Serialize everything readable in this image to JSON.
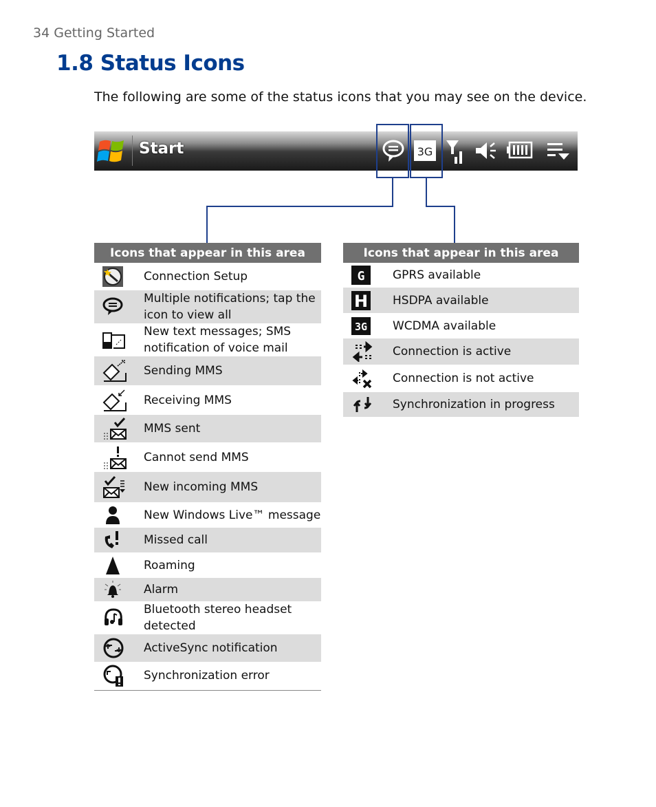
{
  "page_header": "34  Getting Started",
  "title": "1.8  Status Icons",
  "intro": "The following are some of the status icons that you may see on the device.",
  "taskbar": {
    "start_label": "Start",
    "icons": [
      "windows-logo",
      "notification-bubble",
      "3g",
      "signal",
      "speaker",
      "battery",
      "menu-dropdown"
    ],
    "highlighted": [
      "notification-bubble",
      "3g"
    ]
  },
  "left_table": {
    "header": "Icons that appear in this area",
    "rows": [
      {
        "icon": "connection-setup",
        "label": "Connection Setup"
      },
      {
        "icon": "multiple-notifications",
        "label": "Multiple notifications; tap the icon to view all"
      },
      {
        "icon": "new-text-messages",
        "label": "New text messages; SMS notification of voice mail"
      },
      {
        "icon": "sending-mms",
        "label": "Sending MMS"
      },
      {
        "icon": "receiving-mms",
        "label": "Receiving MMS"
      },
      {
        "icon": "mms-sent",
        "label": "MMS sent"
      },
      {
        "icon": "cannot-send-mms",
        "label": "Cannot send MMS"
      },
      {
        "icon": "new-incoming-mms",
        "label": "New incoming MMS"
      },
      {
        "icon": "windows-live",
        "label": "New Windows Live™ message"
      },
      {
        "icon": "missed-call",
        "label": "Missed call"
      },
      {
        "icon": "roaming",
        "label": "Roaming"
      },
      {
        "icon": "alarm",
        "label": "Alarm"
      },
      {
        "icon": "bluetooth-headset",
        "label": "Bluetooth stereo headset detected"
      },
      {
        "icon": "activesync",
        "label": "ActiveSync notification"
      },
      {
        "icon": "sync-error",
        "label": "Synchronization error"
      }
    ]
  },
  "right_table": {
    "header": "Icons that appear in this area",
    "rows": [
      {
        "icon": "gprs",
        "glyph": "G",
        "label": "GPRS available"
      },
      {
        "icon": "hsdpa",
        "glyph": "H",
        "label": "HSDPA available"
      },
      {
        "icon": "wcdma",
        "glyph": "3G",
        "label": "WCDMA available"
      },
      {
        "icon": "connection-active",
        "label": "Connection is active"
      },
      {
        "icon": "connection-not-active",
        "label": "Connection is not active"
      },
      {
        "icon": "sync-progress",
        "label": "Synchronization in progress"
      }
    ]
  }
}
